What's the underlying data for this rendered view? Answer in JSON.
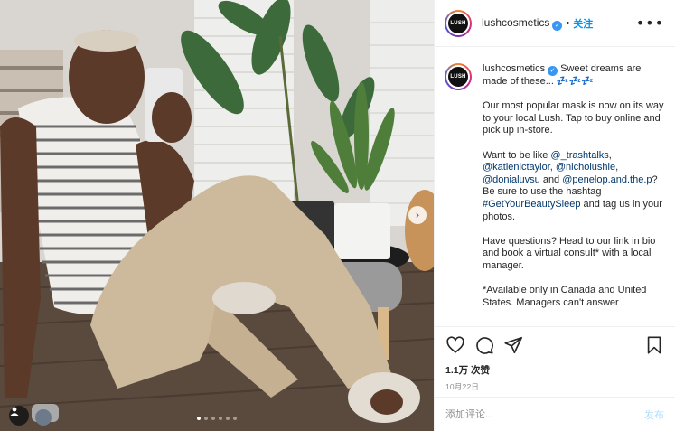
{
  "media": {
    "description_icon": "photo",
    "next_icon": "chevron-right",
    "user_tag_icon": "person-icon",
    "carousel": {
      "count": 6,
      "active_index": 0
    }
  },
  "header": {
    "avatar_text": "LUSH",
    "username": "lushcosmetics",
    "verified_icon": "check",
    "separator": "•",
    "follow_label": "关注",
    "more_icon": "•••"
  },
  "caption": {
    "avatar_text": "LUSH",
    "username": "lushcosmetics",
    "intro": " Sweet dreams are made of these... 💤💤💤",
    "para1": "Our most popular mask is now on its way to your local Lush. Tap to buy online and pick up in-store.",
    "para2_prefix": "Want to be like ",
    "mentions": [
      "@_trashtalks",
      "@katienictaylor",
      "@nicholushie",
      "@donialuvsu",
      "@penelop.and.the.p"
    ],
    "para2_sep1": ",",
    "para2_sep2": ",",
    "para2_sep3": ",",
    "para2_and": " and",
    "para2_mid": "? Be sure to use the hashtag ",
    "hashtag": "#GetYourBeautySleep",
    "para2_suffix": " and tag us in your photos.",
    "para3": "Have questions? Head to our link in bio and book a virtual consult* with a local manager.",
    "para4": "*Available only in Canada and United States. Managers can't answer"
  },
  "actions": {
    "like_icon": "heart-icon",
    "comment_icon": "comment-icon",
    "share_icon": "share-icon",
    "save_icon": "bookmark-icon",
    "likes": "1.1万 次赞",
    "date": "10月22日"
  },
  "comment_box": {
    "placeholder": "添加评论...",
    "post_label": "发布"
  },
  "colors": {
    "accent": "#0095f6",
    "post_disabled": "#b2dffc",
    "verified": "#3897f0",
    "link": "#00376b"
  }
}
